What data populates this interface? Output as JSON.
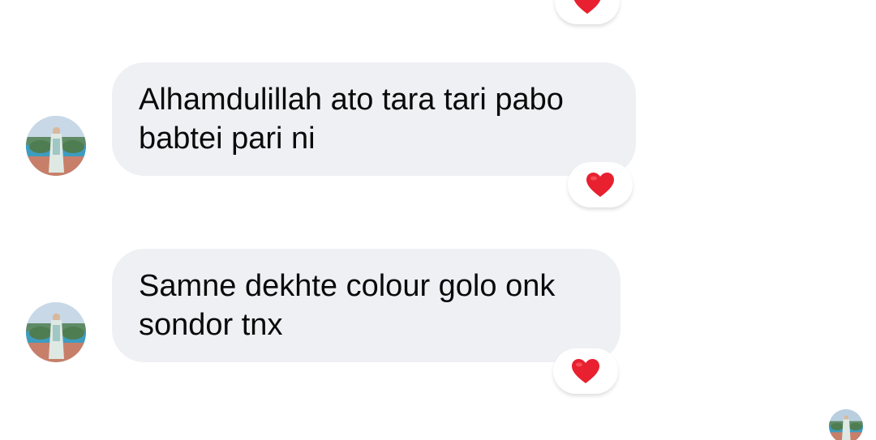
{
  "messages": [
    {
      "lines": [
        "Alhamdulillah ato tara tari pabo",
        "babtei pari ni"
      ],
      "reaction": "heart-icon"
    },
    {
      "lines": [
        "Samne dekhte colour golo onk",
        "sondor tnx"
      ],
      "reaction": "heart-icon"
    }
  ],
  "colors": {
    "bubble_bg": "#eef0f4",
    "heart": "#e8202f",
    "text": "#0a0a0a"
  }
}
